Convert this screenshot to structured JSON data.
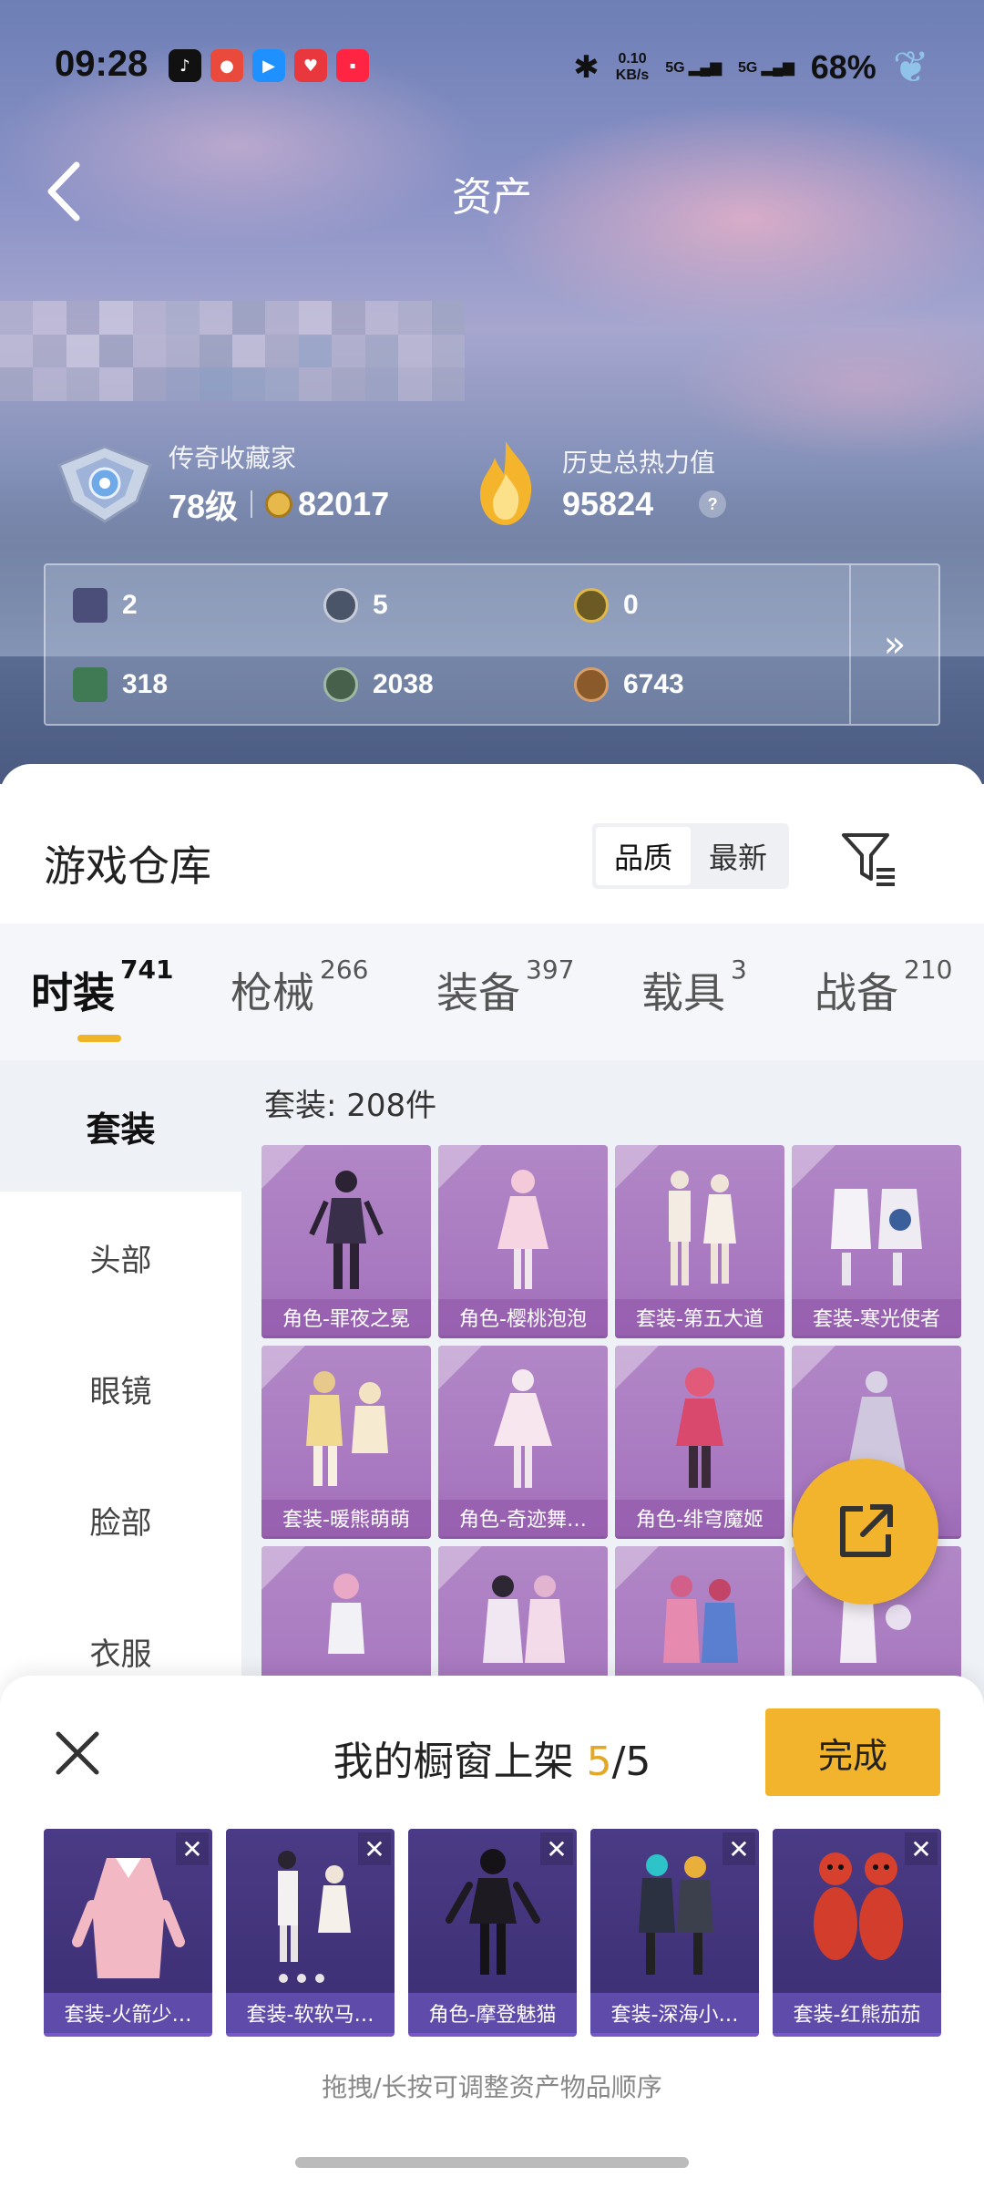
{
  "status_bar": {
    "time": "09:28",
    "app_icons": [
      "tiktok-icon",
      "weibo-icon",
      "video-icon",
      "heart-app-icon",
      "xiaohongshu-icon"
    ],
    "net_speed_value": "0.10",
    "net_speed_unit": "KB/s",
    "sim1": "5G",
    "sim2": "5G",
    "battery": "68%"
  },
  "header": {
    "title": "资产"
  },
  "profile": {
    "rank_title": "传奇收藏家",
    "level": "78级",
    "coins": "82017",
    "heat_title": "历史总热力值",
    "heat_value": "95824",
    "help": "?"
  },
  "stats": [
    {
      "icon": "card-icon",
      "value": "2",
      "color": "#4a4e78"
    },
    {
      "icon": "silver-coin-icon",
      "value": "5",
      "color": "#4b5569"
    },
    {
      "icon": "gold-badge-icon",
      "value": "0",
      "color": "#6b5a24"
    },
    {
      "icon": "green-card-icon",
      "value": "318",
      "color": "#3f7a55"
    },
    {
      "icon": "green-coin-icon",
      "value": "2038",
      "color": "#46604c"
    },
    {
      "icon": "bronze-coin-icon",
      "value": "6743",
      "color": "#8a5a2a"
    }
  ],
  "stats_more": "»",
  "warehouse": {
    "title": "游戏仓库",
    "sort_options": [
      "品质",
      "最新"
    ],
    "tabs": [
      {
        "label": "时装",
        "count": "741"
      },
      {
        "label": "枪械",
        "count": "266"
      },
      {
        "label": "装备",
        "count": "397"
      },
      {
        "label": "载具",
        "count": "3"
      },
      {
        "label": "战备",
        "count": "210"
      }
    ],
    "sidebar": [
      "套装",
      "头部",
      "眼镜",
      "脸部",
      "衣服"
    ],
    "count_label": "套装: 208件",
    "items": [
      {
        "label": "角色-罪夜之冕"
      },
      {
        "label": "角色-樱桃泡泡"
      },
      {
        "label": "套装-第五大道"
      },
      {
        "label": "套装-寒光使者"
      },
      {
        "label": "套装-暖熊萌萌"
      },
      {
        "label": "角色-奇迹舞…"
      },
      {
        "label": "角色-绯穹魔姬"
      },
      {
        "label": ""
      },
      {
        "label": ""
      },
      {
        "label": ""
      },
      {
        "label": ""
      },
      {
        "label": ""
      }
    ]
  },
  "showcase": {
    "title_prefix": "我的橱窗上架",
    "count_current": "5",
    "count_total": "/5",
    "done": "完成",
    "slots": [
      {
        "label": "套装-火箭少…"
      },
      {
        "label": "套装-软软马…"
      },
      {
        "label": "角色-摩登魅猫"
      },
      {
        "label": "套装-深海小…"
      },
      {
        "label": "套装-红熊茄茄"
      }
    ],
    "hint": "拖拽/长按可调整资产物品顺序"
  },
  "colors": {
    "accent": "#f3b42d",
    "card_purple": "#a878c0",
    "slot_purple": "#3b2e72"
  }
}
